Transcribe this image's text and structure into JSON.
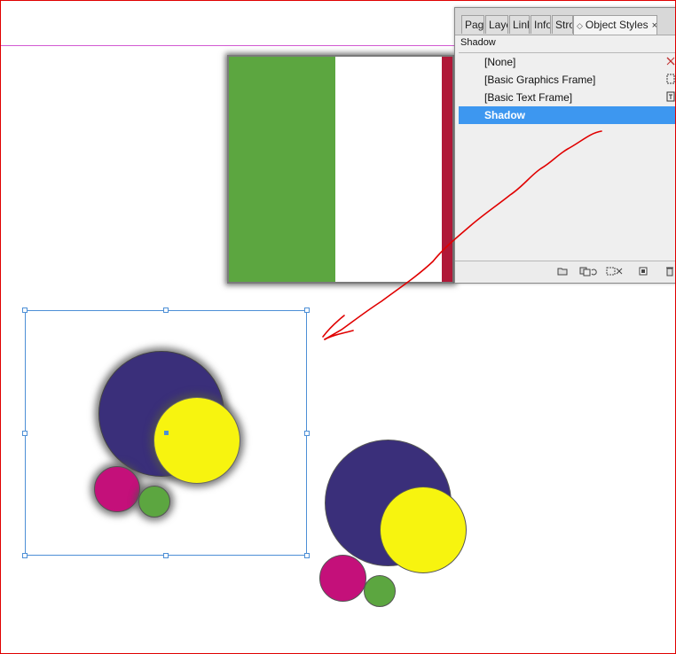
{
  "panel": {
    "tabs": [
      {
        "label": "Pag"
      },
      {
        "label": "Laye"
      },
      {
        "label": "Link"
      },
      {
        "label": "Info"
      },
      {
        "label": "Stro"
      },
      {
        "label": "Object Styles",
        "active": true
      }
    ],
    "close_glyph": "×",
    "menu_glyph": "◇",
    "current_style": "Shadow",
    "styles": [
      {
        "label": "[None]",
        "icon": "none-style-icon"
      },
      {
        "label": "[Basic Graphics Frame]",
        "icon": "graphics-frame-icon"
      },
      {
        "label": "[Basic Text Frame]",
        "icon": "text-frame-icon"
      },
      {
        "label": "Shadow",
        "selected": true
      }
    ],
    "bottom_icons": [
      "folder-icon",
      "clear-overrides-icon",
      "clear-attributes-icon",
      "new-style-icon",
      "trash-icon"
    ]
  },
  "colors": {
    "navy": "#3a2f7a",
    "yellow": "#f7f40f",
    "magenta": "#c4107a",
    "green": "#5ca640",
    "flag_red": "#b01838",
    "selection_blue": "#4d8fd6",
    "annotation_red": "#e00000"
  }
}
